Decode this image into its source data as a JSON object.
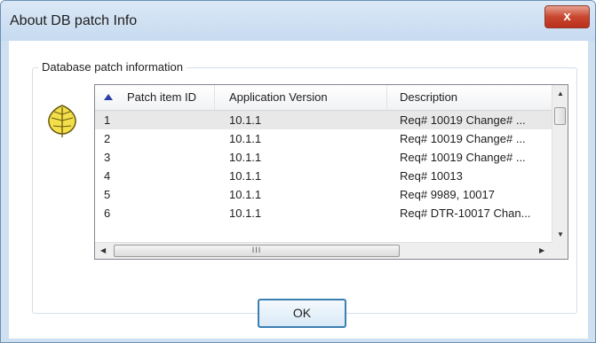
{
  "window": {
    "title": "About DB patch Info",
    "close_label": "x"
  },
  "group": {
    "label": "Database patch information"
  },
  "table": {
    "columns": [
      "Patch item ID",
      "Application Version",
      "Description"
    ],
    "rows": [
      {
        "id": "1",
        "version": "10.1.1",
        "description": "Req# 10019 Change# ..."
      },
      {
        "id": "2",
        "version": "10.1.1",
        "description": "Req# 10019 Change# ..."
      },
      {
        "id": "3",
        "version": "10.1.1",
        "description": "Req# 10019 Change# ..."
      },
      {
        "id": "4",
        "version": "10.1.1",
        "description": "Req# 10013"
      },
      {
        "id": "5",
        "version": "10.1.1",
        "description": "Req# 9989, 10017"
      },
      {
        "id": "6",
        "version": "10.1.1",
        "description": "Req# DTR-10017 Chan..."
      }
    ],
    "selected_row": 0,
    "hscroll_grip": "III"
  },
  "buttons": {
    "ok_label": "OK"
  },
  "icons": {
    "app_icon": "leaf-icon",
    "sort": "sort-ascending-icon"
  },
  "colors": {
    "title_bg": "#cfe0f1",
    "close_red": "#c9472f",
    "ok_border": "#3c7fb1"
  }
}
